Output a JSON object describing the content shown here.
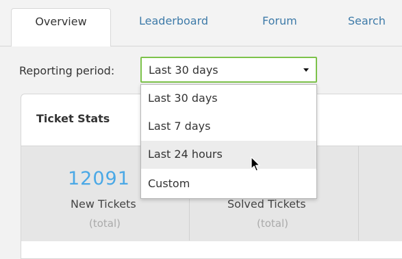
{
  "tabs": [
    {
      "label": "Overview",
      "active": true
    },
    {
      "label": "Leaderboard"
    },
    {
      "label": "Forum"
    },
    {
      "label": "Search"
    }
  ],
  "reporting": {
    "label": "Reporting period:",
    "selected": "Last 30 days",
    "options": [
      "Last 30 days",
      "Last 7 days",
      "Last 24 hours",
      "Custom"
    ],
    "hovered": "Last 24 hours"
  },
  "panel": {
    "title": "Ticket Stats",
    "stats": [
      {
        "value": "12091",
        "name": "New Tickets",
        "note": "(total)"
      },
      {
        "name": "Solved Tickets",
        "note": "(total)"
      }
    ]
  },
  "colors": {
    "accent": "#3d7aa8",
    "focus": "#7cc24a",
    "stat": "#4aa8e6"
  },
  "icons": {
    "cursor": "mouse-pointer-icon",
    "caret": "caret-down-icon"
  }
}
